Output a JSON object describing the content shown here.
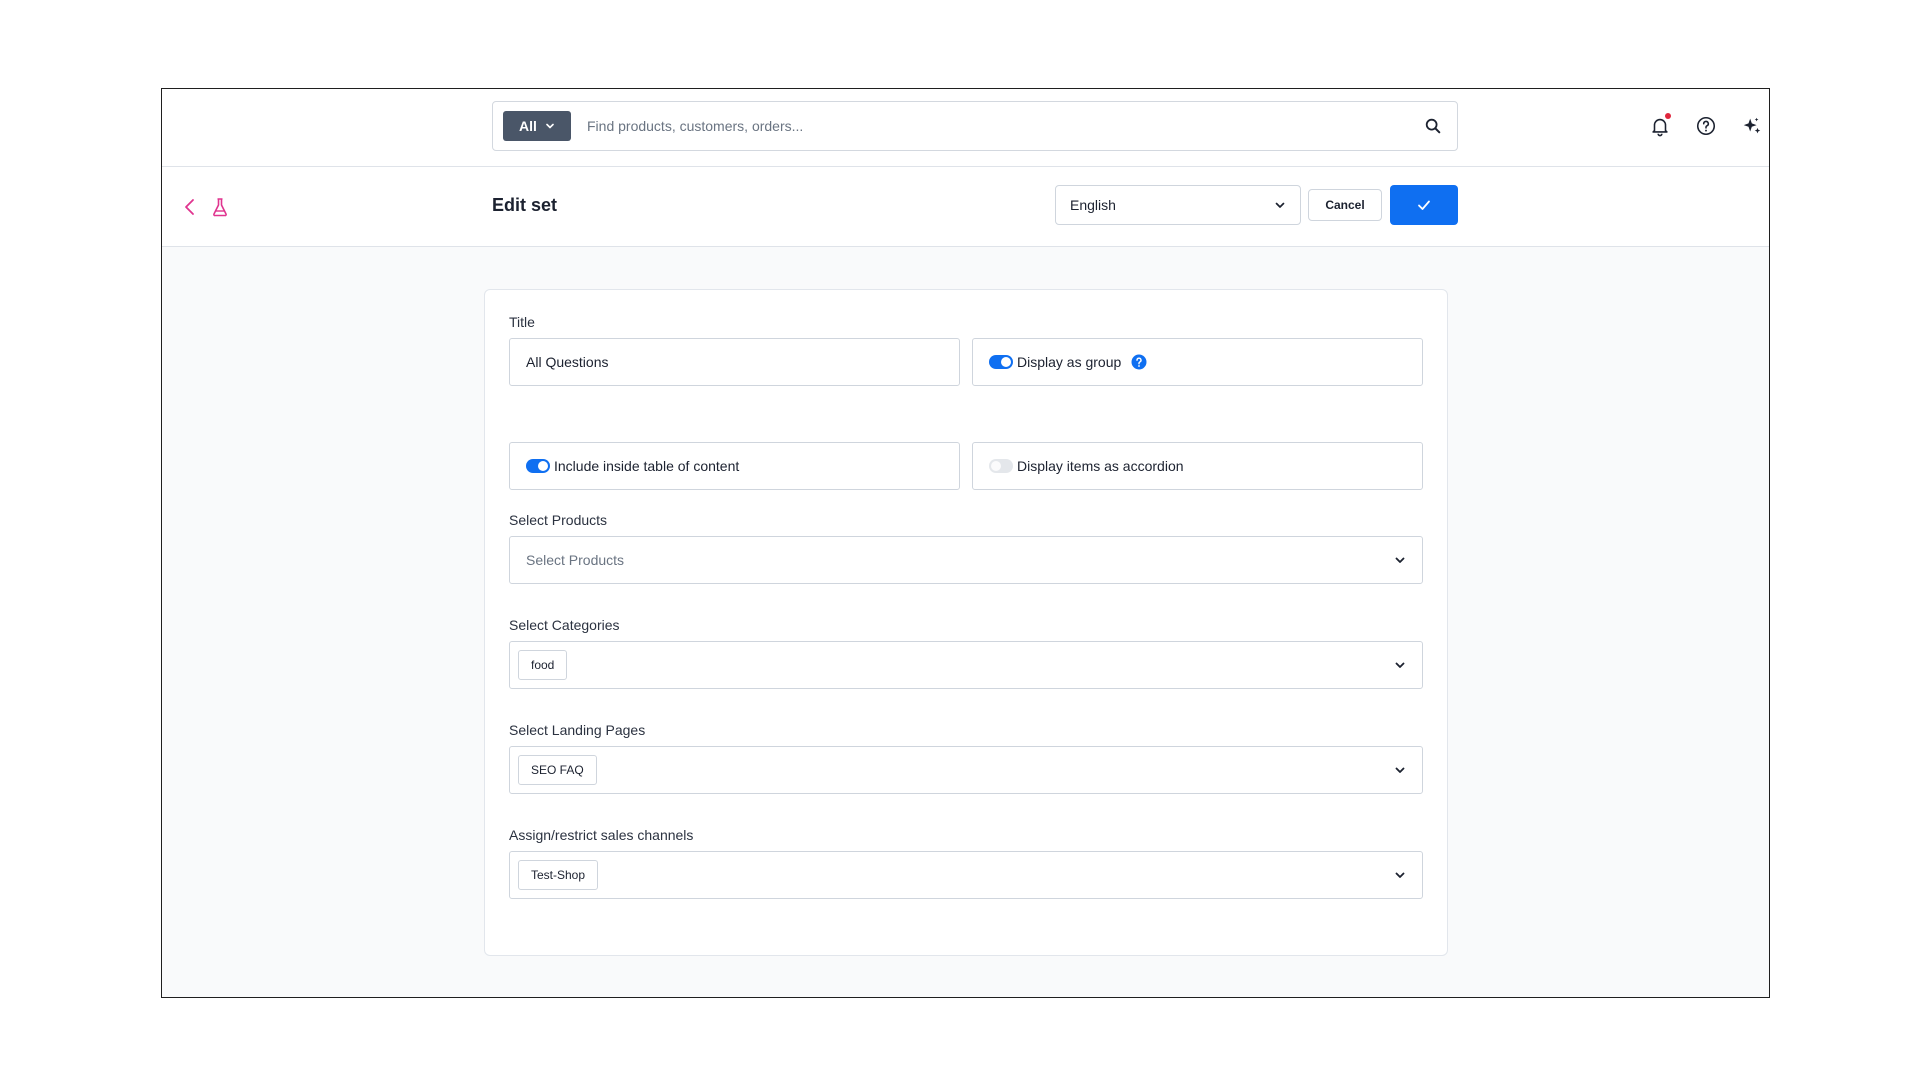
{
  "topbar": {
    "search": {
      "scope_label": "All",
      "placeholder": "Find products, customers, orders...",
      "value": ""
    },
    "icons": [
      "bell-icon",
      "help-icon",
      "sparkle-icon"
    ]
  },
  "header": {
    "title": "Edit set",
    "language": "English",
    "cancel_label": "Cancel"
  },
  "form": {
    "title_label": "Title",
    "title_value": "All Questions",
    "display_as_group": {
      "label": "Display as group",
      "enabled": true
    },
    "include_toc": {
      "label": "Include inside table of content",
      "enabled": true
    },
    "accordion": {
      "label": "Display items as accordion",
      "enabled": false
    },
    "products": {
      "label": "Select Products",
      "placeholder": "Select Products"
    },
    "categories": {
      "label": "Select Categories",
      "tags": [
        "food"
      ]
    },
    "landing_pages": {
      "label": "Select Landing Pages",
      "tags": [
        "SEO FAQ"
      ]
    },
    "sales_channels": {
      "label": "Assign/restrict sales channels",
      "tags": [
        "Test-Shop"
      ]
    }
  },
  "colors": {
    "accent": "#0f6ff1",
    "pink_icons": "#e0348f",
    "search_scope_bg": "#4a5668",
    "notification_dot": "#e0263d"
  }
}
